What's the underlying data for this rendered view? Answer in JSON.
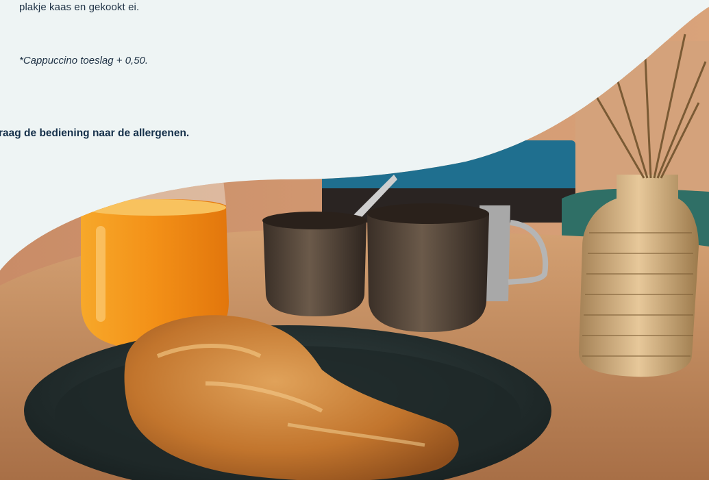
{
  "menu": {
    "description_tail": "plakje kaas en gekookt ei.",
    "surcharge_note": "*Cappuccino toeslag + 0,50.",
    "allergen_note": "raag de bediening naar de allergenen."
  },
  "photo": {
    "subject": "croissant-orange-juice-coffee-breakfast",
    "colors": {
      "background": "#eef4f4",
      "text": "#203346",
      "text_bold": "#15304a",
      "table_wood": "#c99567",
      "orange_juice": "#f39a1c",
      "cup_brown": "#5a4a3c",
      "plate_dark": "#1f2b2b",
      "croissant": "#c6782f",
      "vase_gold": "#c9a46a",
      "bench_blue": "#1f6f8f"
    }
  }
}
